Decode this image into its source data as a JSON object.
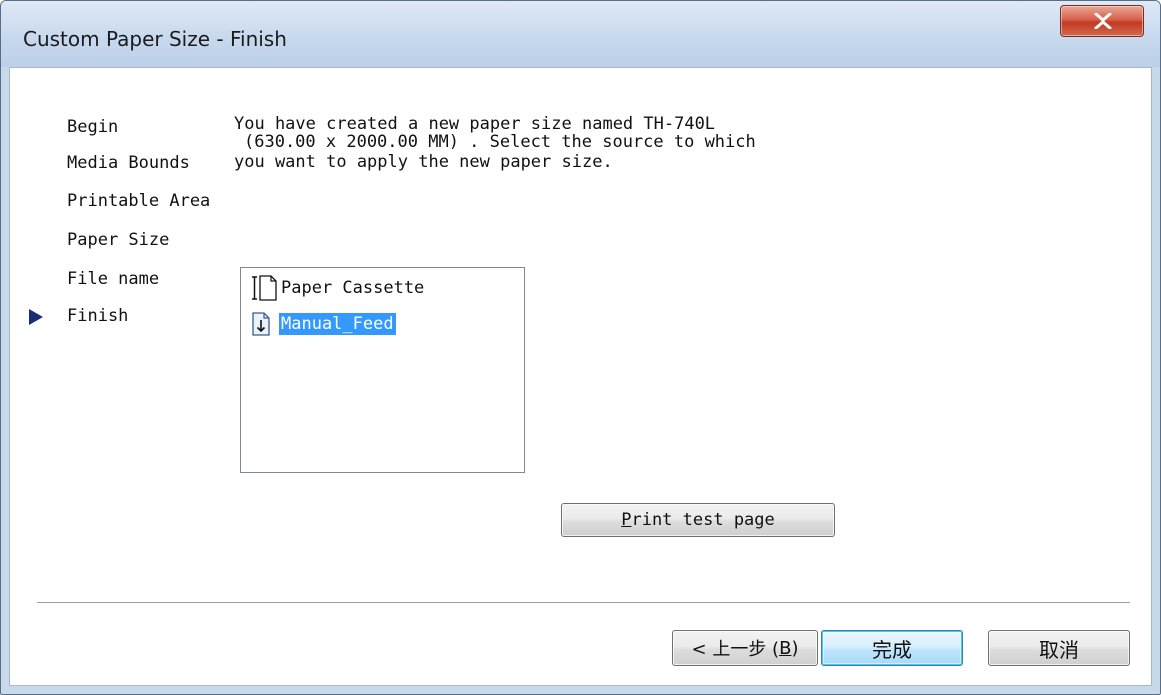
{
  "window": {
    "title": "Custom Paper Size - Finish",
    "close_label": "X"
  },
  "steps": [
    {
      "label": "Begin",
      "current": false
    },
    {
      "label": "Media Bounds",
      "current": false
    },
    {
      "label": "Printable Area",
      "current": false
    },
    {
      "label": "Paper Size",
      "current": false
    },
    {
      "label": "File name",
      "current": false
    },
    {
      "label": "Finish",
      "current": true
    }
  ],
  "description": {
    "line1": "You have created a new paper size named TH-740L",
    "line2": "(630.00 x 2000.00 MM) . Select the source to which",
    "line3": "you want to apply the new paper size."
  },
  "sources": {
    "items": [
      {
        "label": "Paper Cassette",
        "icon": "paper-cassette-icon",
        "selected": false
      },
      {
        "label": "Manual_Feed",
        "icon": "manual-feed-icon",
        "selected": true
      }
    ]
  },
  "buttons": {
    "print_test_underline": "P",
    "print_test_rest": "rint test page",
    "back_prefix": "< 上一步 (",
    "back_accel": "B",
    "back_suffix": ")",
    "finish": "完成",
    "cancel": "取消"
  },
  "colors": {
    "selection": "#3399ff",
    "close_button": "#c23a22",
    "default_button_border": "#3c7fb1"
  }
}
